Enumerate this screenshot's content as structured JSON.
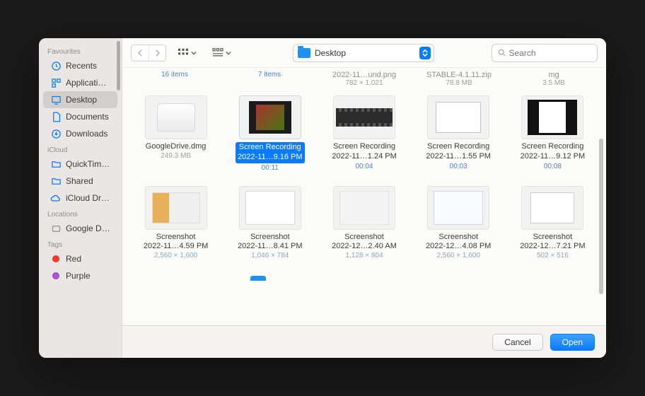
{
  "sidebar": {
    "sections": {
      "favourites": {
        "label": "Favourites",
        "items": [
          {
            "label": "Recents",
            "icon": "clock"
          },
          {
            "label": "Applicati…",
            "icon": "apps"
          },
          {
            "label": "Desktop",
            "icon": "desktop",
            "selected": true
          },
          {
            "label": "Documents",
            "icon": "doc"
          },
          {
            "label": "Downloads",
            "icon": "download"
          }
        ]
      },
      "icloud": {
        "label": "iCloud",
        "items": [
          {
            "label": "QuickTim…",
            "icon": "folder"
          },
          {
            "label": "Shared",
            "icon": "folder"
          },
          {
            "label": "iCloud Dri…",
            "icon": "cloud"
          }
        ]
      },
      "locations": {
        "label": "Locations",
        "items": [
          {
            "label": "Google D…",
            "icon": "disk"
          }
        ]
      },
      "tags": {
        "label": "Tags",
        "items": [
          {
            "label": "Red",
            "color": "#ff3b30"
          },
          {
            "label": "Purple",
            "color": "#af52de"
          }
        ]
      }
    }
  },
  "toolbar": {
    "location": "Desktop",
    "search_placeholder": "Search"
  },
  "partial_row": [
    {
      "count": "16 items"
    },
    {
      "count": "7 items"
    },
    {
      "name": "2022-11…und.png",
      "meta": "782 × 1,021"
    },
    {
      "name": "STABLE-4.1.11.zip",
      "meta": "78.8 MB"
    },
    {
      "name": "mg",
      "meta": "3.5 MB"
    }
  ],
  "grid": [
    {
      "name": "GoogleDrive.dmg",
      "meta": "249.3 MB",
      "thumb": "dmg"
    },
    {
      "name_l1": "Screen Recording",
      "name_l2": "2022-11…9.16 PM",
      "duration": "00:11",
      "thumb": "vid1",
      "selected": true
    },
    {
      "name_l1": "Screen Recording",
      "name_l2": "2022-11…1.24 PM",
      "duration": "00:04",
      "thumb": "filmstrip"
    },
    {
      "name_l1": "Screen Recording",
      "name_l2": "2022-11…1.55 PM",
      "duration": "00:03",
      "thumb": "doc"
    },
    {
      "name_l1": "Screen Recording",
      "name_l2": "2022-11…9.12 PM",
      "duration": "00:08",
      "thumb": "docdark"
    },
    {
      "name_l1": "Screenshot",
      "name_l2": "2022-11…4.59 PM",
      "meta": "2,560 × 1,600",
      "thumb": "shot1"
    },
    {
      "name_l1": "Screenshot",
      "name_l2": "2022-11…8.41 PM",
      "meta": "1,046 × 784",
      "thumb": "appwin"
    },
    {
      "name_l1": "Screenshot",
      "name_l2": "2022-12…2.40 AM",
      "meta": "1,128 × 804",
      "thumb": "gray"
    },
    {
      "name_l1": "Screenshot",
      "name_l2": "2022-12…4.08 PM",
      "meta": "2,560 × 1,600",
      "thumb": "bluewin"
    },
    {
      "name_l1": "Screenshot",
      "name_l2": "2022-12…7.21 PM",
      "meta": "502 × 516",
      "thumb": "window"
    }
  ],
  "footer": {
    "cancel": "Cancel",
    "open": "Open"
  }
}
